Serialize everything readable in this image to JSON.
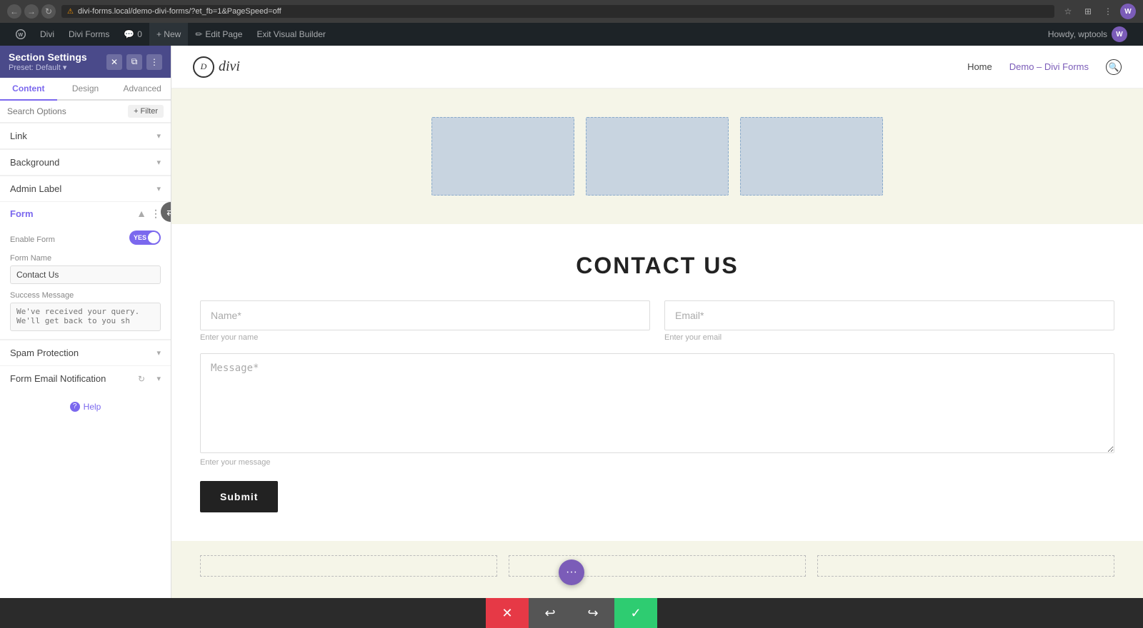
{
  "browser": {
    "url": "divi-forms.local/demo-divi-forms/?et_fb=1&PageSpeed=off",
    "back_label": "←",
    "forward_label": "→",
    "reload_label": "↻",
    "lock_label": "⚠",
    "lock_text": "Not secure",
    "avatar_label": "W"
  },
  "wp_admin_bar": {
    "wp_icon": "W",
    "divi_label": "Divi",
    "divi_forms_label": "Divi Forms",
    "comments_count": "0",
    "new_label": "+ New",
    "edit_page_label": "Edit Page",
    "exit_vb_label": "Exit Visual Builder",
    "howdy_label": "Howdy, wptools"
  },
  "sidebar": {
    "title": "Section Settings",
    "preset": "Preset: Default ▾",
    "tab_content": "Content",
    "tab_design": "Design",
    "tab_advanced": "Advanced",
    "search_placeholder": "Search Options",
    "filter_label": "+ Filter",
    "link_label": "Link",
    "background_label": "Background",
    "admin_label_label": "Admin Label",
    "form_label": "Form",
    "enable_form_label": "Enable Form",
    "toggle_yes": "YES",
    "form_name_label": "Form Name",
    "form_name_value": "Contact Us",
    "success_message_label": "Success Message",
    "success_message_placeholder": "We've received your query. We'll get back to you sh",
    "spam_protection_label": "Spam Protection",
    "form_email_notification_label": "Form Email Notification",
    "help_label": "Help"
  },
  "site": {
    "logo_text": "divi",
    "nav_home": "Home",
    "nav_demo": "Demo – Divi Forms",
    "contact_title": "CONTACT US",
    "name_label": "Name*",
    "name_placeholder": "Enter your name",
    "email_label": "Email*",
    "email_placeholder": "Enter your email",
    "message_label": "Message*",
    "message_placeholder": "Enter your message",
    "submit_label": "Submit"
  }
}
